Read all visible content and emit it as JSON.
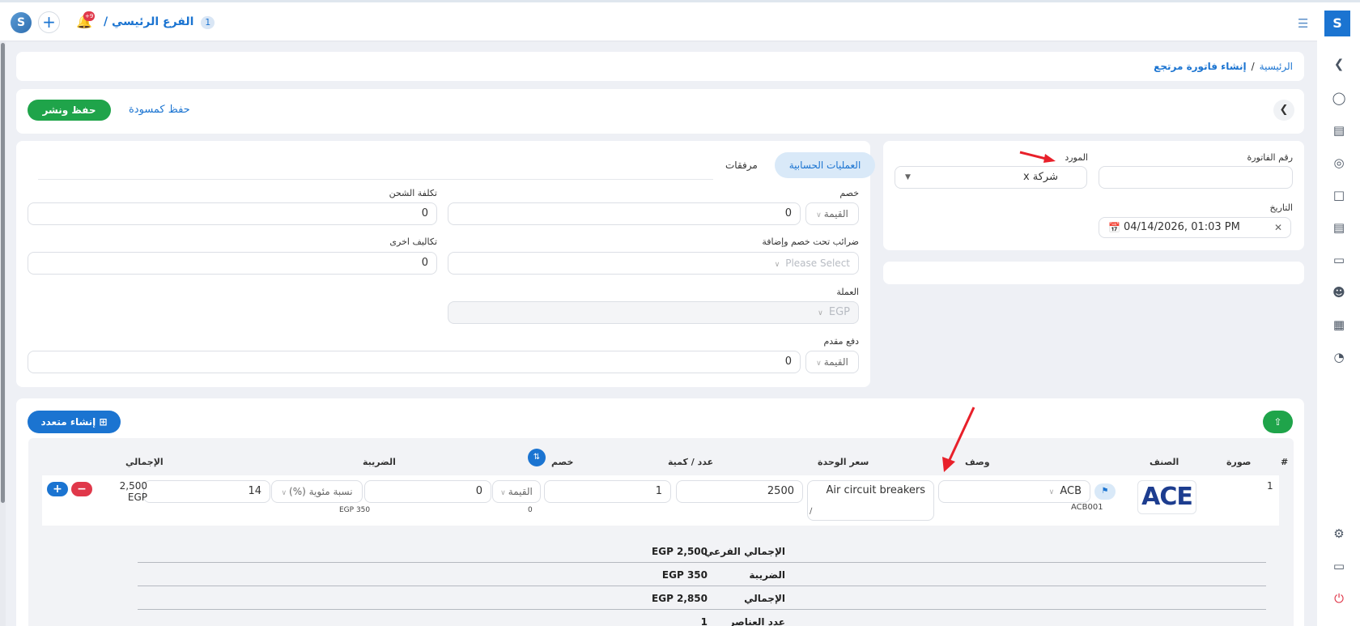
{
  "topbar": {
    "branch_number": "1",
    "branch_name": "الفرع الرئيسي /",
    "notifications_count": "+9"
  },
  "breadcrumb": {
    "home": "الرئيسية",
    "separator": "/",
    "current": "إنشاء فاتورة مرتجع"
  },
  "actions": {
    "publish": "حفظ ونشر",
    "draft": "حفظ كمسودة"
  },
  "invoice": {
    "invoice_number_label": "رقم الفاتورة",
    "invoice_number_value": "",
    "supplier_label": "المورد",
    "supplier_value": "شركة x",
    "date_label": "التاريخ",
    "date_value": "04/14/2026, 01:03 PM"
  },
  "tabs": {
    "active": "العمليات الحسابية",
    "other": "مرفقات"
  },
  "calc": {
    "discount_label": "خصم",
    "discount_type": "القيمة",
    "discount_value": "0",
    "shipping_label": "تكلفة الشحن",
    "shipping_value": "0",
    "taxes_label": "ضرائب تحت خصم وإضافة",
    "taxes_placeholder": "Please Select",
    "other_costs_label": "تكاليف اخرى",
    "other_costs_value": "0",
    "currency_label": "العملة",
    "currency_value": "EGP",
    "advance_label": "دفع مقدم",
    "advance_type": "القيمة",
    "advance_value": "0"
  },
  "items": {
    "create_multi": "إنشاء متعدد",
    "headers": {
      "num": "#",
      "image": "صورة",
      "item": "الصنف",
      "description": "وصف",
      "unit_price": "سعر الوحدة",
      "qty": "عدد / كمية",
      "discount": "خصم",
      "tax": "الضريبة",
      "total": "الإجمالي"
    },
    "row": {
      "num": "1",
      "logo_text": "ACE",
      "item_value": "ACB",
      "item_code": "ACB001",
      "description": "Air circuit breakers",
      "unit_price": "2500",
      "qty": "1",
      "discount_type": "القيمة",
      "discount_value": "0",
      "discount_amount": "0",
      "tax_type": "نسبة مئوية (%)",
      "tax_value": "14",
      "tax_amount": "EGP 350",
      "total_amount": "2,500",
      "total_currency": "EGP"
    }
  },
  "summary": [
    {
      "label": "الإجمالي الفرعي",
      "value": "EGP 2,500"
    },
    {
      "label": "الضريبة",
      "value": "EGP 350"
    },
    {
      "label": "الإجمالي",
      "value": "EGP 2,850"
    },
    {
      "label": "عدد العناصر",
      "value": "1"
    }
  ],
  "icons": {
    "brand": "brand-logo-icon",
    "add": "plus-icon",
    "bell": "bell-icon",
    "menu": "hamburger-icon",
    "back": "chevron-left-icon"
  },
  "colors": {
    "primary": "#1b74d1",
    "success": "#1fa44a",
    "danger": "#e0384a",
    "annotation_arrow": "#e8202a"
  }
}
